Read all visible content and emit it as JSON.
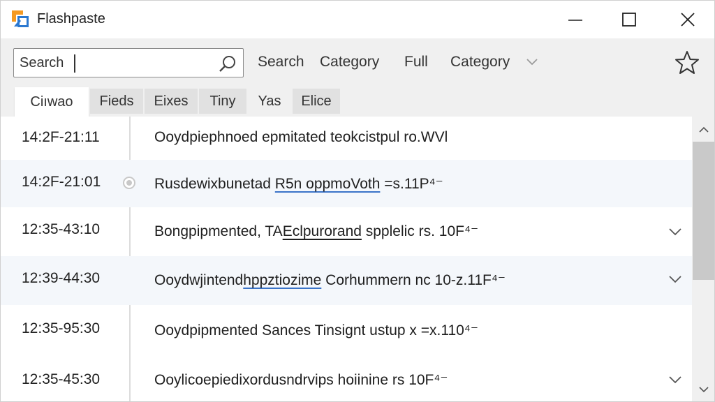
{
  "app": {
    "title": "Flashpaste"
  },
  "icons": {
    "logo": "flashpaste-logo-icon",
    "minimize": "minimize-icon",
    "maximize": "maximize-icon",
    "close": "close-icon",
    "search": "search-icon",
    "dropdown": "chevron-down-icon",
    "favorite": "star-icon",
    "expand": "chevron-down-icon",
    "scroll_up": "chevron-up-icon",
    "scroll_down": "chevron-down-icon"
  },
  "colors": {
    "accent_orange": "#f59a23",
    "accent_blue": "#2b78d0",
    "link_underline": "#3a73c8"
  },
  "toolbar": {
    "search_value": "Search",
    "search_label": "Search",
    "category_label": "Category",
    "full_label": "Full",
    "category_dropdown_label": "Category"
  },
  "tabs": [
    {
      "label": "Ciıwao"
    },
    {
      "label": "Fieds"
    },
    {
      "label": "Eixes"
    },
    {
      "label": "Tiny"
    },
    {
      "label": "Yas"
    },
    {
      "label": "Elice"
    }
  ],
  "rows": [
    {
      "time": "14:2F-21:11",
      "text": "Ooydpiephnoed epmitated teokcistpul ro.WVl"
    },
    {
      "time": "14:2F-21:01",
      "text_a": "Rusdewixbunetad ",
      "text_b": "R5n oppmoVoth",
      "text_c": " =s.11P⁴⁻"
    },
    {
      "time": "12:35-43:10",
      "text_a": "Bongpipmented, TA",
      "text_b": "Eclpurorand",
      "text_c": " spplelic rs. 10F⁴⁻"
    },
    {
      "time": "12:39-44:30",
      "text_a": "Ooydwjintend",
      "text_b": "hppztiozime",
      "text_c": " Corhummern nc 10-z.11F⁴⁻"
    },
    {
      "time": "12:35-95:30",
      "text": "Ooydpipmented Sances Tinsignt ustup x =x.110⁴⁻"
    },
    {
      "time": "12:35-45:30",
      "text": "Ooylicoepiedixordusndrvips hoiinine rs 10F⁴⁻"
    }
  ]
}
